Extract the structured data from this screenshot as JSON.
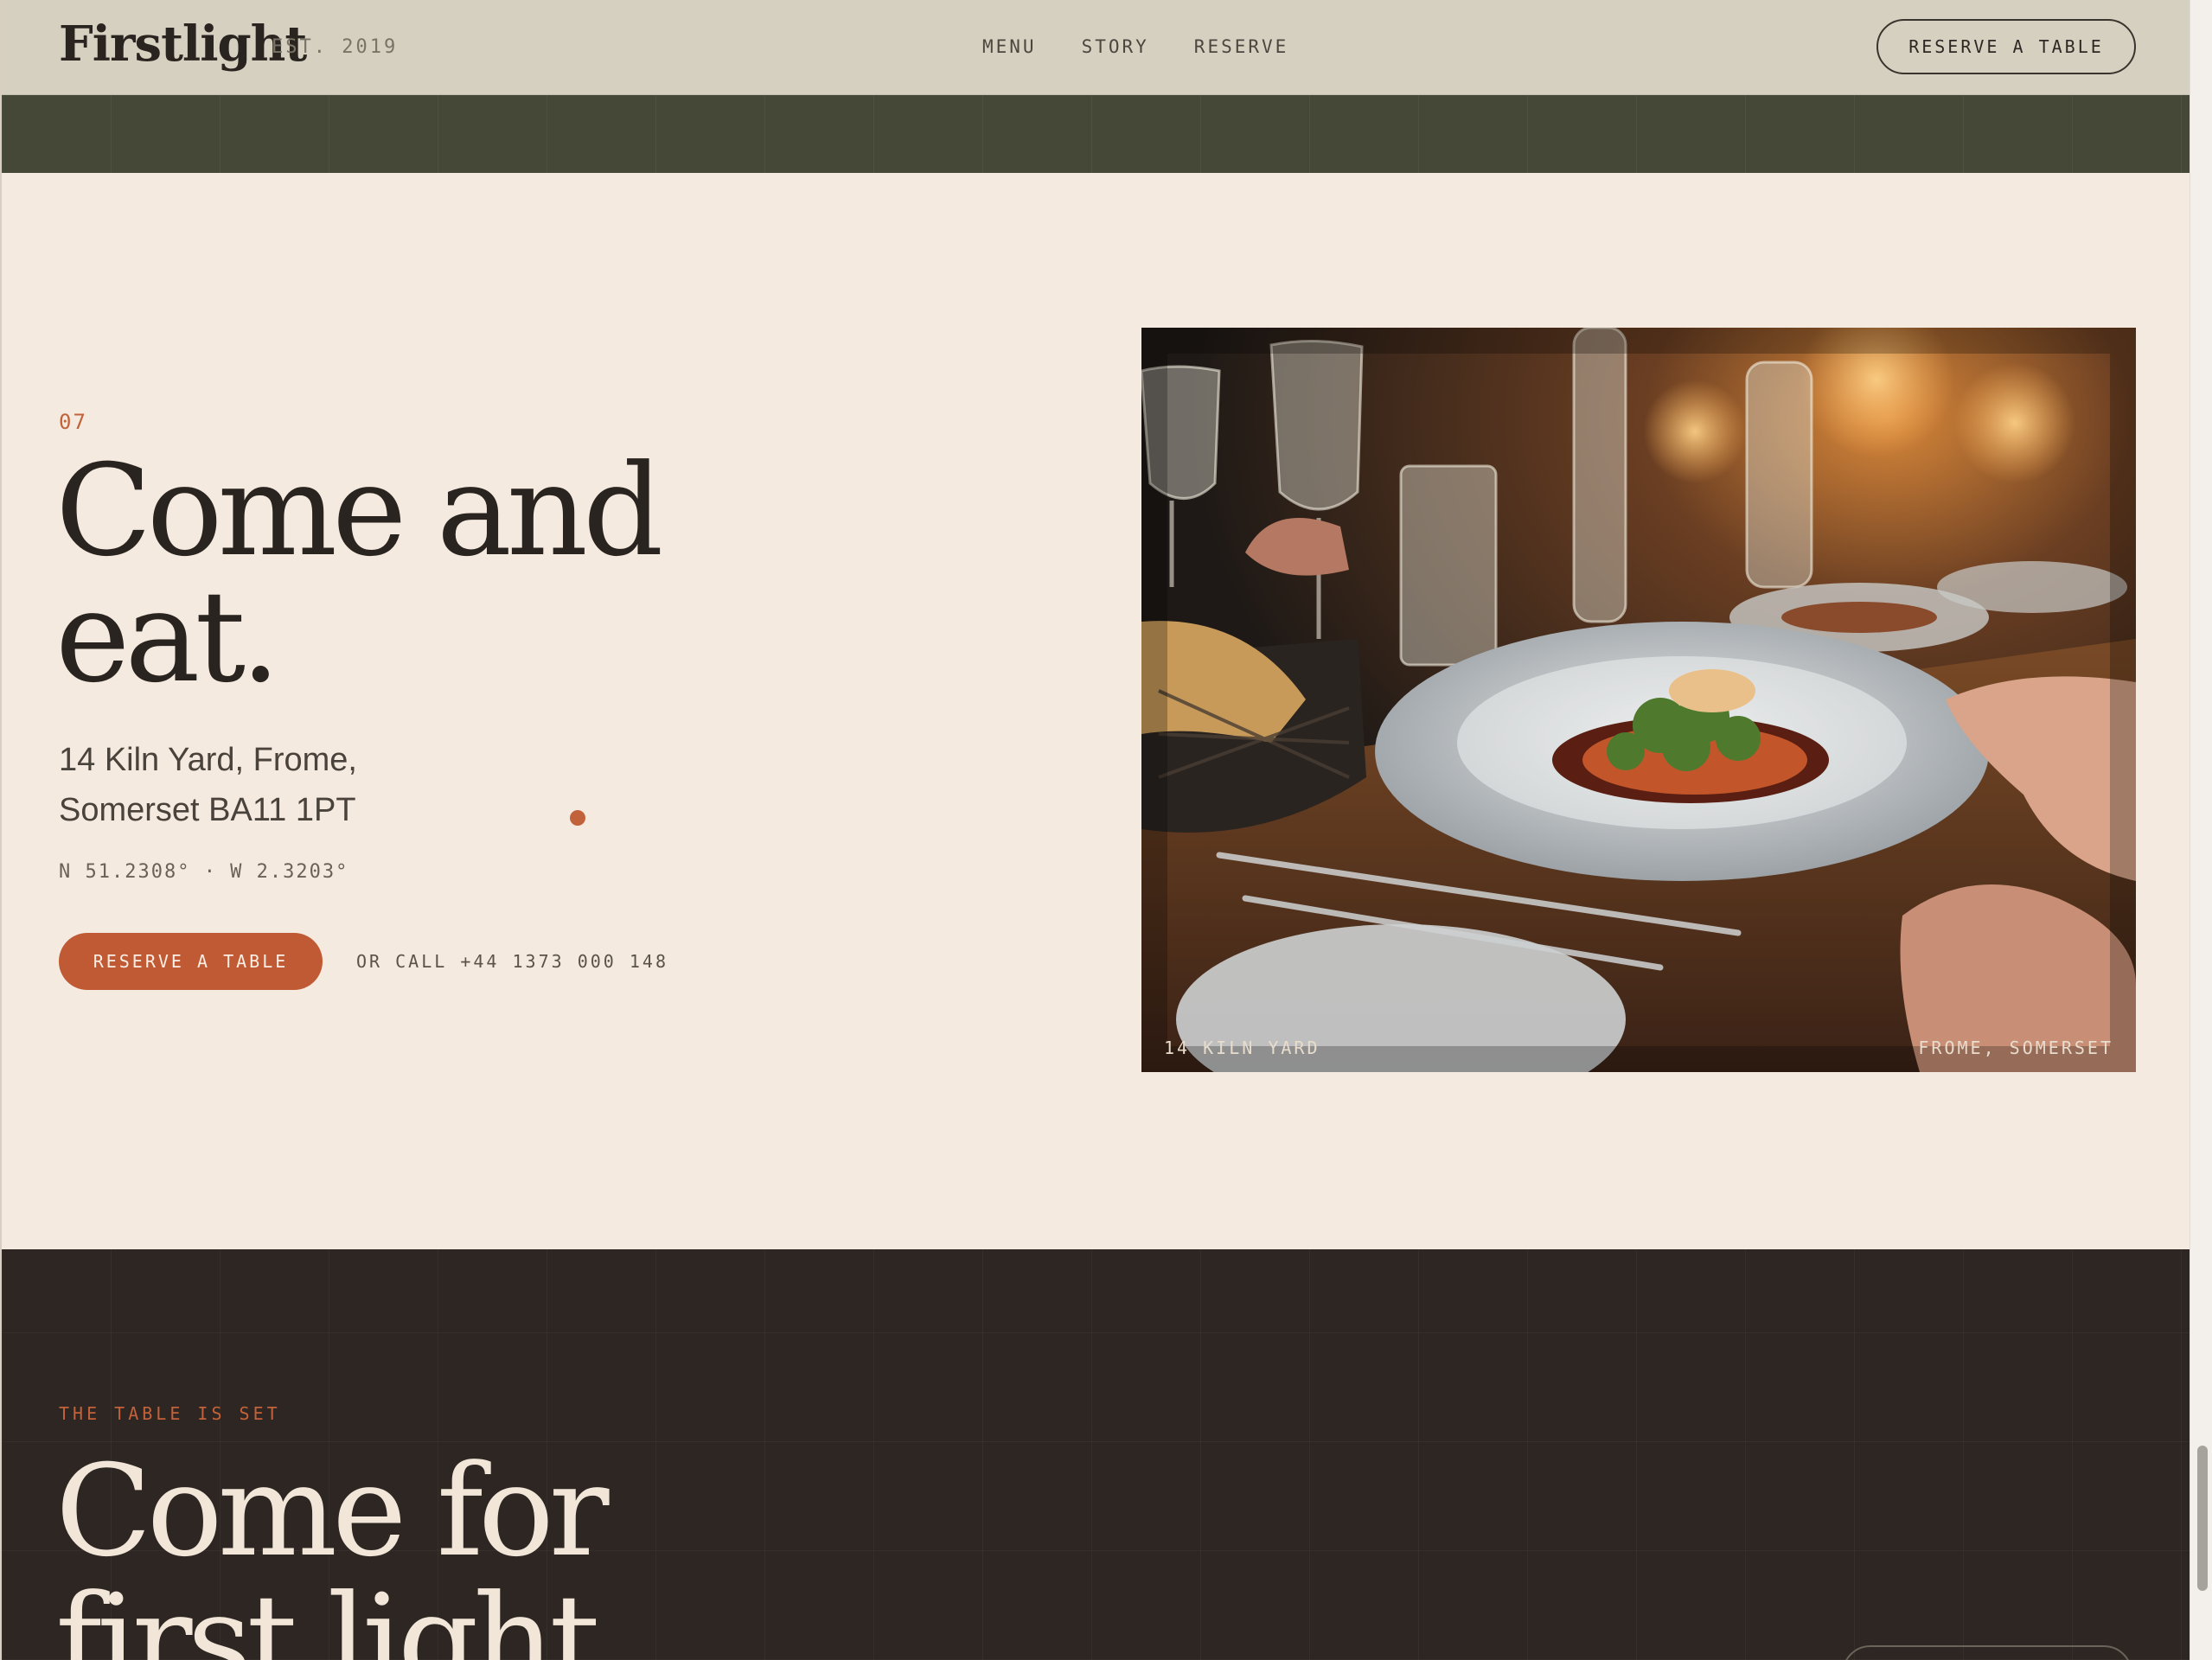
{
  "header": {
    "logo": "Firstlight",
    "est": "EST. 2019",
    "nav": [
      "MENU",
      "STORY",
      "RESERVE"
    ],
    "cta_label": "RESERVE A TABLE"
  },
  "hero": {
    "number": "07",
    "title_line1": "Come and",
    "title_line2": "eat.",
    "address_line1": "14 Kiln Yard, Frome,",
    "address_line2": "Somerset BA11 1PT",
    "coordinates": "N 51.2308°  ·  W 2.3203°",
    "cta_label": "RESERVE A TABLE",
    "call_text": "OR CALL +44 1373 000 148",
    "photo_caption_left": "14 KILN YARD",
    "photo_caption_right": "FROME, SOMERSET"
  },
  "next_section": {
    "kicker": "THE TABLE IS SET",
    "title_line1": "Come for",
    "title_line2": "first light"
  },
  "colors": {
    "accent": "#c05a34",
    "header_bg": "#d6d0c1",
    "band": "#454836",
    "page_bg": "#f5eadf",
    "dark_bg": "#2e2622"
  }
}
